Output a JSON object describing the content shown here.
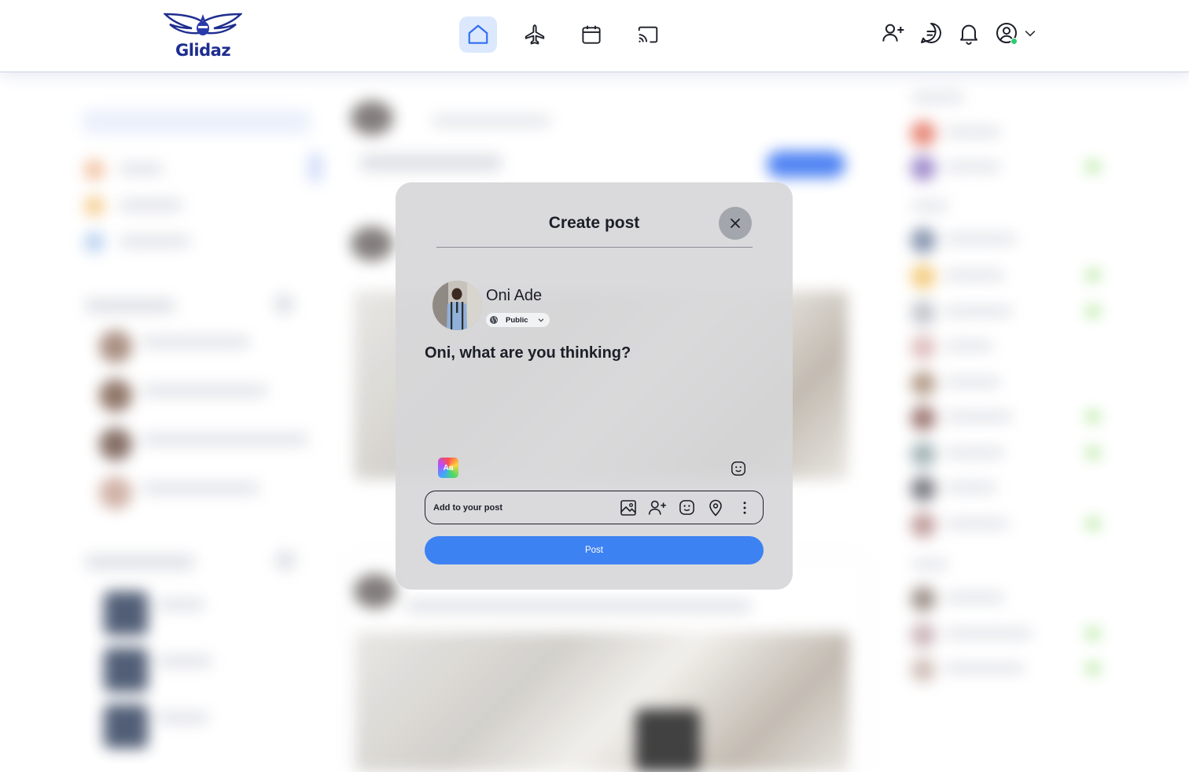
{
  "brand": {
    "name": "Glidaz"
  },
  "topnav": {
    "center": [
      {
        "icon": "home-icon",
        "active": true
      },
      {
        "icon": "plane-icon",
        "active": false
      },
      {
        "icon": "calendar-icon",
        "active": false
      },
      {
        "icon": "cast-icon",
        "active": false
      }
    ],
    "right": [
      "add-friend-icon",
      "message-icon",
      "bell-icon",
      "user-profile-icon",
      "chevron-down-icon"
    ]
  },
  "modal": {
    "title": "Create post",
    "user_name": "Oni Ade",
    "privacy": "Public",
    "prompt": "Oni, what are you thinking?",
    "text_style_label": "Aa",
    "add_to_post_label": "Add to your post",
    "add_icons": [
      "photo-icon",
      "tag-people-icon",
      "feeling-icon",
      "location-icon",
      "more-icon"
    ],
    "post_button": "Post"
  },
  "colors": {
    "primary": "#3d82f2",
    "brand": "#1e2d8f",
    "online": "#2ecc71"
  }
}
